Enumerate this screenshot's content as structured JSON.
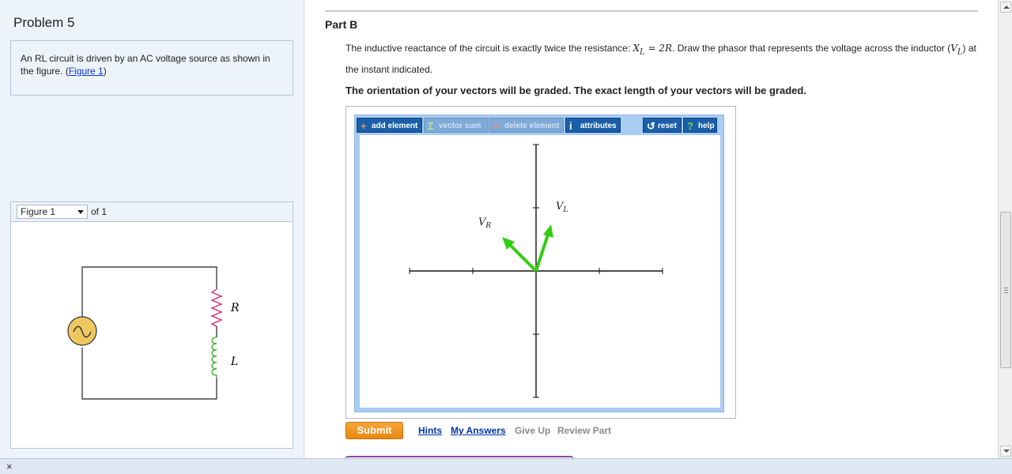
{
  "left": {
    "problem_title": "Problem 5",
    "description": "An RL circuit is driven by an AC voltage source as shown in the figure. (",
    "figure_link": "Figure 1",
    "description_end": ")",
    "figure_select": "Figure 1",
    "figure_of": "of 1",
    "circuit": {
      "resistor_label": "R",
      "inductor_label": "L"
    }
  },
  "right": {
    "part_title": "Part B",
    "question_1": "The inductive reactance of the circuit is exactly twice the resistance: ",
    "question_math": "X_L = 2R",
    "question_2": ". Draw the phasor that represents the voltage across the inductor (",
    "question_math2": "V_L",
    "question_3": ") at the instant indicated.",
    "graded_note": "The orientation of your vectors will be graded. The exact length of your vectors will be graded.",
    "toolbar": {
      "add_element": "add element",
      "vector_sum": "vector sum",
      "delete_element": "delete element",
      "attributes": "attributes",
      "reset": "reset",
      "help": "help"
    },
    "canvas": {
      "label_vr": "V",
      "label_vr_sub": "R",
      "label_vl": "V",
      "label_vl_sub": "L"
    },
    "actions": {
      "submit": "Submit",
      "hints": "Hints",
      "my_answers": "My Answers",
      "give_up": "Give Up",
      "review_part": "Review Part"
    }
  },
  "colors": {
    "vector": "#33cc11",
    "accent": "#1a5fa8",
    "submit": "#f29a2e",
    "resistor": "#cc2277",
    "inductor": "#33aa22",
    "source": "#f0c860"
  },
  "bottom": {
    "close": "×"
  }
}
